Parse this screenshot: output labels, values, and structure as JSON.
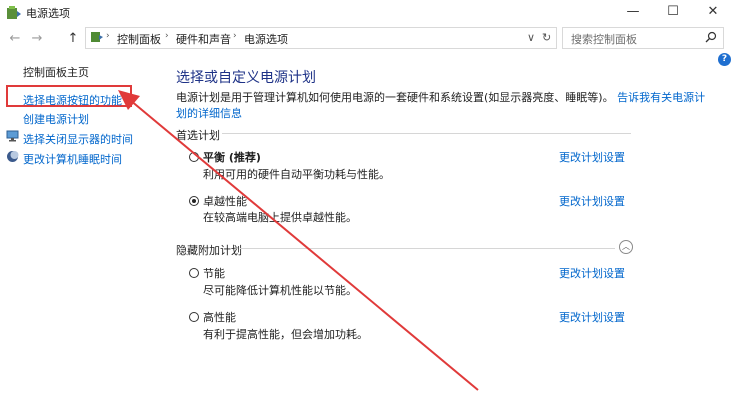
{
  "window": {
    "title": "电源选项",
    "minimize": "—",
    "maximize": "☐",
    "close": "✕"
  },
  "nav": {
    "back": "←",
    "forward": "→",
    "up": "↑",
    "dropdown": "∨",
    "refresh": "↻"
  },
  "breadcrumb": [
    "控制面板",
    "硬件和声音",
    "电源选项"
  ],
  "search": {
    "placeholder": "搜索控制面板"
  },
  "sidebar": {
    "items": [
      {
        "label": "控制面板主页"
      },
      {
        "label": "选择电源按钮的功能"
      },
      {
        "label": "创建电源计划"
      },
      {
        "label": "选择关闭显示器的时间"
      },
      {
        "label": "更改计算机睡眠时间"
      }
    ]
  },
  "main": {
    "title": "选择或自定义电源计划",
    "description_line1": "电源计划是用于管理计算机如何使用电源的一套硬件和系统设置(如显示器亮度、睡眠等)。",
    "description_link_line1": "告诉我有关电源计",
    "description_link_line2": "划的详细信息",
    "preferred_label": "首选计划",
    "hidden_label": "隐藏附加计划",
    "plans": [
      {
        "name": "平衡 (推荐)",
        "desc": "利用可用的硬件自动平衡功耗与性能。",
        "link": "更改计划设置",
        "selected": false
      },
      {
        "name": "卓越性能",
        "desc": "在较高端电脑上提供卓越性能。",
        "link": "更改计划设置",
        "selected": true
      },
      {
        "name": "节能",
        "desc": "尽可能降低计算机性能以节能。",
        "link": "更改计划设置",
        "selected": false
      },
      {
        "name": "高性能",
        "desc": "有利于提高性能，但会增加功耗。",
        "link": "更改计划设置",
        "selected": false
      }
    ]
  },
  "help": "?",
  "colors": {
    "accent_link": "#0066cc",
    "heading": "#1e3287",
    "annotation_red": "#e03a3a"
  }
}
